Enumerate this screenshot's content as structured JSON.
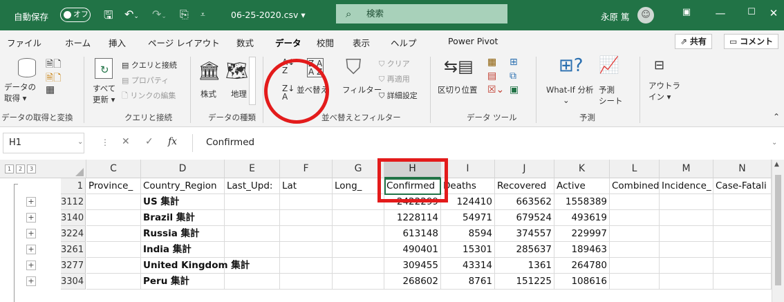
{
  "titlebar": {
    "autosave": "自動保存",
    "toggle": "オフ",
    "filename": "06-25-2020.csv ▾",
    "search_placeholder": "検索",
    "user": "永原 篤"
  },
  "menu": {
    "tabs": [
      "ファイル",
      "ホーム",
      "挿入",
      "ページ レイアウト",
      "数式",
      "データ",
      "校閲",
      "表示",
      "ヘルプ",
      "Power Pivot"
    ],
    "active": "データ",
    "share": "共有",
    "comment": "コメント"
  },
  "ribbon": {
    "get_data": [
      "データの",
      "取得 ▾"
    ],
    "refresh_all": [
      "すべて",
      "更新 ▾"
    ],
    "queries_connections": "クエリと接続",
    "properties": "プロパティ",
    "edit_links": "リンクの編集",
    "stocks": "株式",
    "geography": "地理",
    "sort": "並べ替え",
    "filter": "フィルター",
    "clear": "クリア",
    "reapply": "再適用",
    "advanced": "詳細設定",
    "text_to_columns": "区切り位置",
    "what_if": "What-If 分析",
    "forecast_sheet": [
      "予測",
      "シート"
    ],
    "outline": [
      "アウトラ",
      "イン ▾"
    ],
    "groups": [
      "データの取得と変換",
      "クエリと接続",
      "データの種類",
      "並べ替えとフィルター",
      "データ ツール",
      "予測"
    ]
  },
  "formula_bar": {
    "name_box": "H1",
    "fx": "fx",
    "value": "Confirmed"
  },
  "grid": {
    "outline_levels": [
      "1",
      "2",
      "3"
    ],
    "columns": [
      "C",
      "D",
      "E",
      "F",
      "G",
      "H",
      "I",
      "J",
      "K",
      "L",
      "M",
      "N"
    ],
    "selected_column": "H",
    "header_row": {
      "row": "1",
      "cells": [
        "Province_",
        "Country_Region",
        "Last_Upd:",
        "Lat",
        "Long_",
        "Confirmed",
        "Deaths",
        "Recovered",
        "Active",
        "Combined",
        "Incidence_",
        "Case-Fatali"
      ]
    },
    "rows": [
      {
        "row": "3112",
        "country": "US 集計",
        "confirmed": "2422299",
        "deaths": "124410",
        "recovered": "663562",
        "active": "1558389"
      },
      {
        "row": "3140",
        "country": "Brazil 集計",
        "confirmed": "1228114",
        "deaths": "54971",
        "recovered": "679524",
        "active": "493619"
      },
      {
        "row": "3224",
        "country": "Russia 集計",
        "confirmed": "613148",
        "deaths": "8594",
        "recovered": "374557",
        "active": "229997"
      },
      {
        "row": "3261",
        "country": "India 集計",
        "confirmed": "490401",
        "deaths": "15301",
        "recovered": "285637",
        "active": "189463"
      },
      {
        "row": "3277",
        "country": "United Kingdom 集計",
        "confirmed": "309455",
        "deaths": "43314",
        "recovered": "1361",
        "active": "264780"
      },
      {
        "row": "3304",
        "country": "Peru 集計",
        "confirmed": "268602",
        "deaths": "8761",
        "recovered": "151225",
        "active": "108616"
      }
    ]
  },
  "colors": {
    "accent": "#217346",
    "annotation": "#e31b1b"
  }
}
